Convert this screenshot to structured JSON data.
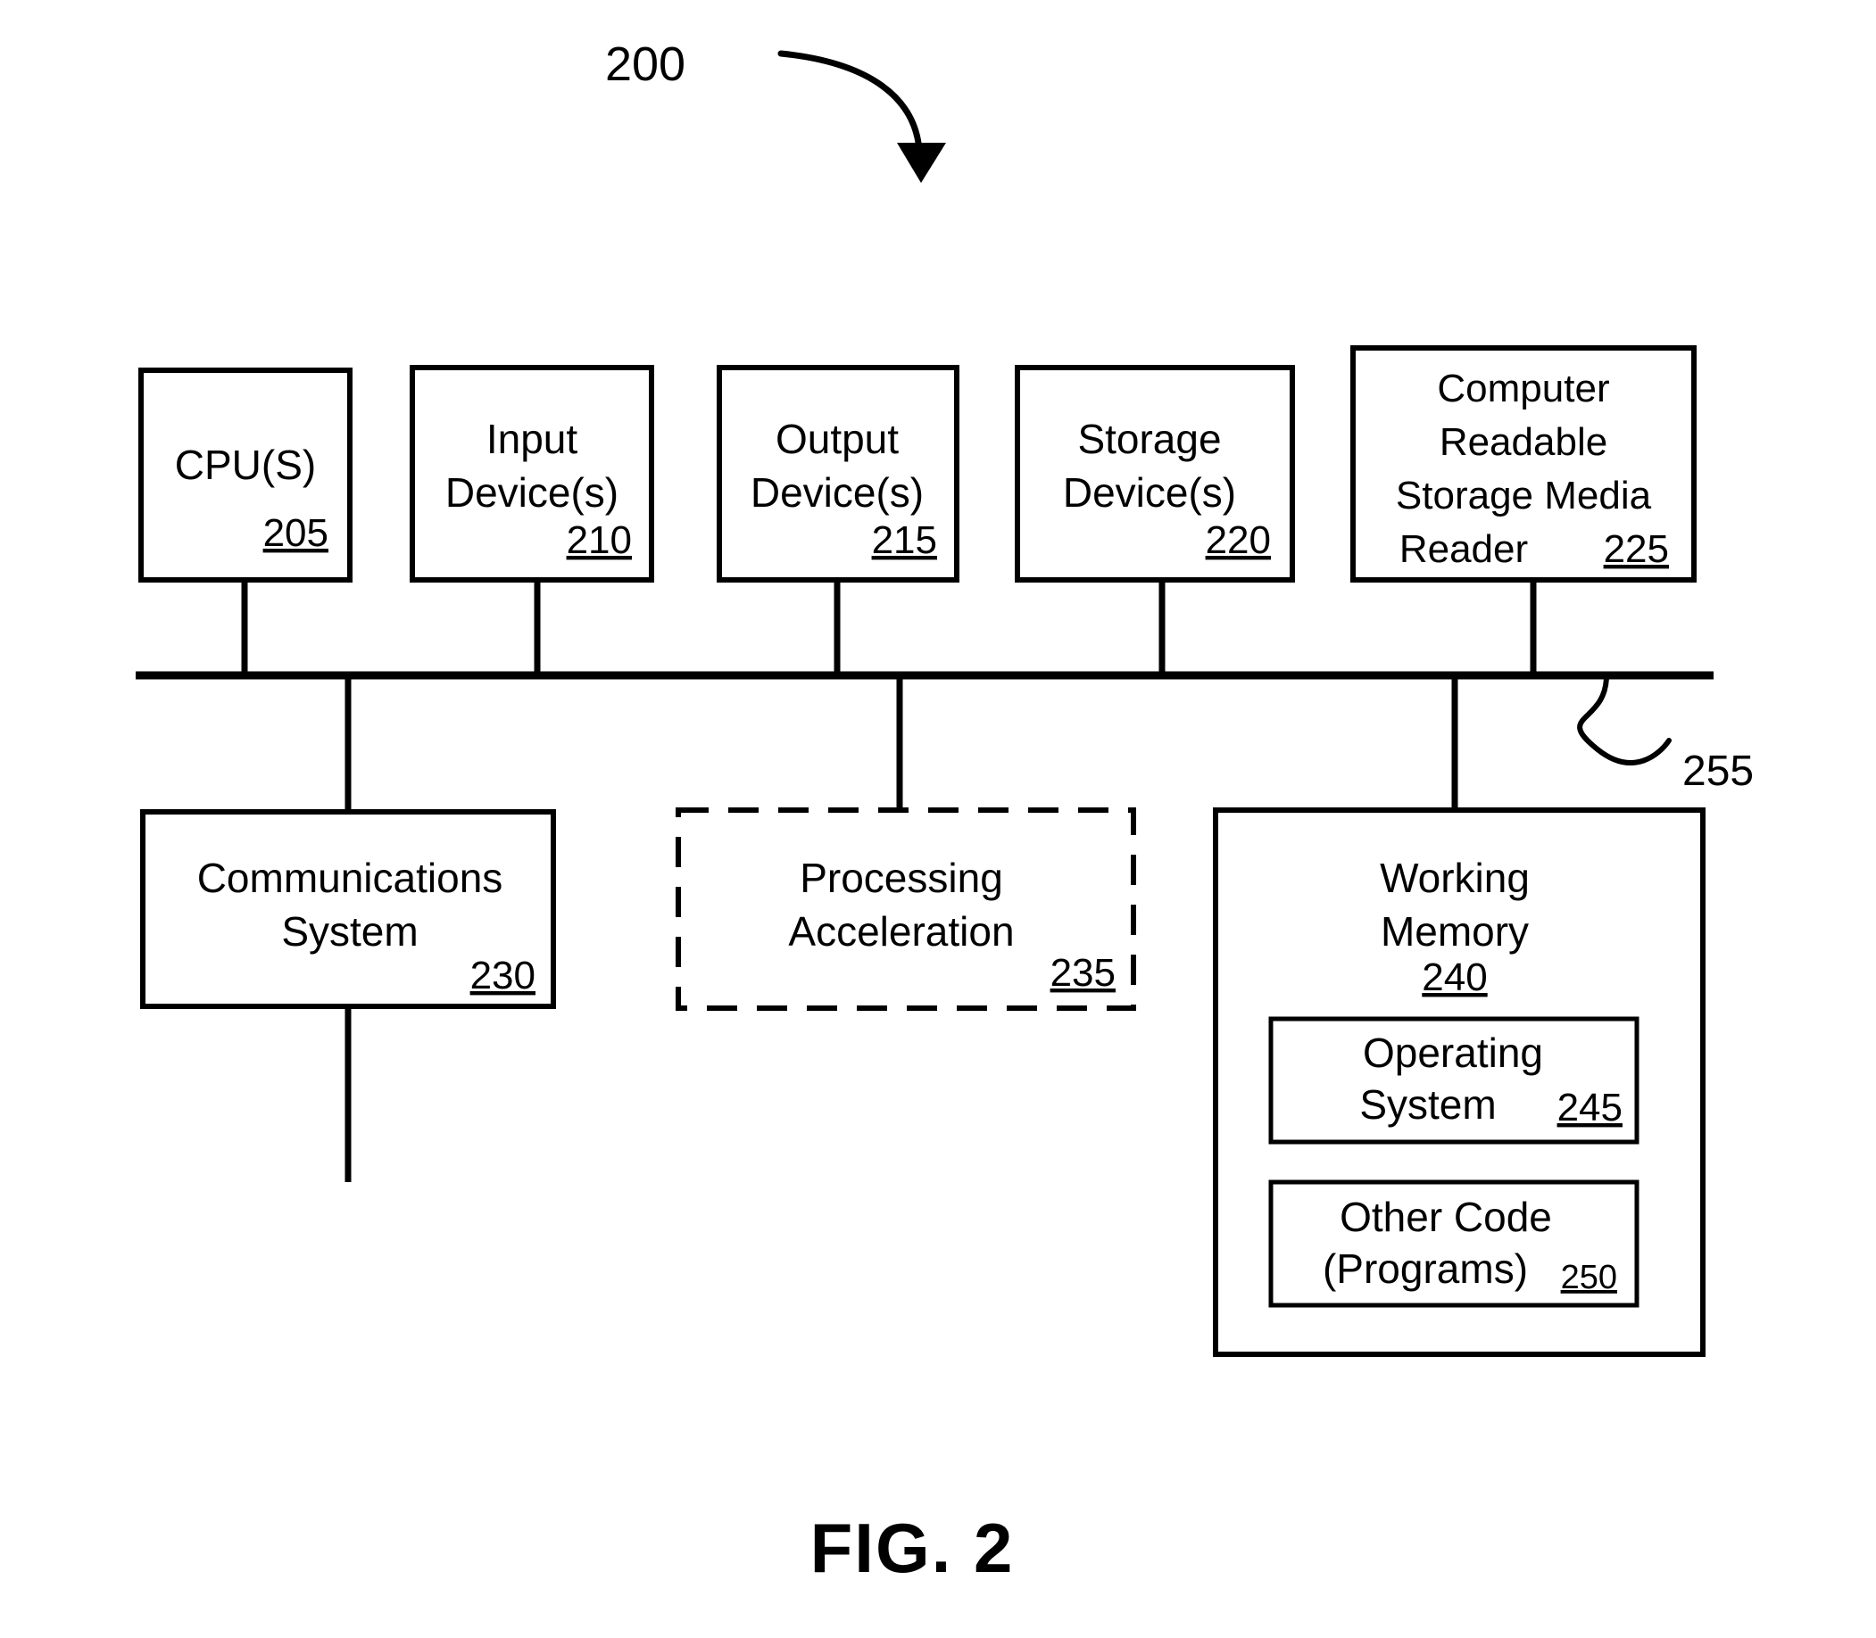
{
  "figure": {
    "caption": "FIG. 2",
    "system_ref": "200",
    "bus_ref": "255"
  },
  "top_row": [
    {
      "name": "cpu",
      "lines": [
        "CPU(S)"
      ],
      "ref": "205"
    },
    {
      "name": "input-devices",
      "lines": [
        "Input",
        "Device(s)"
      ],
      "ref": "210"
    },
    {
      "name": "output-devices",
      "lines": [
        "Output",
        "Device(s)"
      ],
      "ref": "215"
    },
    {
      "name": "storage-devices",
      "lines": [
        "Storage",
        "Device(s)"
      ],
      "ref": "220"
    },
    {
      "name": "computer-readable-storage-media-reader",
      "lines": [
        "Computer",
        "Readable",
        "Storage Media",
        "Reader"
      ],
      "ref": "225"
    }
  ],
  "bottom_row": [
    {
      "name": "communications-system",
      "lines": [
        "Communications",
        "System"
      ],
      "ref": "230",
      "style": "solid"
    },
    {
      "name": "processing-acceleration",
      "lines": [
        "Processing",
        "Acceleration"
      ],
      "ref": "235",
      "style": "dashed"
    },
    {
      "name": "working-memory",
      "lines": [
        "Working",
        "Memory"
      ],
      "ref": "240",
      "style": "solid"
    }
  ],
  "working_memory_children": [
    {
      "name": "operating-system",
      "lines": [
        "Operating",
        "System"
      ],
      "ref": "245"
    },
    {
      "name": "other-code",
      "lines": [
        "Other Code",
        "(Programs)"
      ],
      "ref": "250"
    }
  ]
}
